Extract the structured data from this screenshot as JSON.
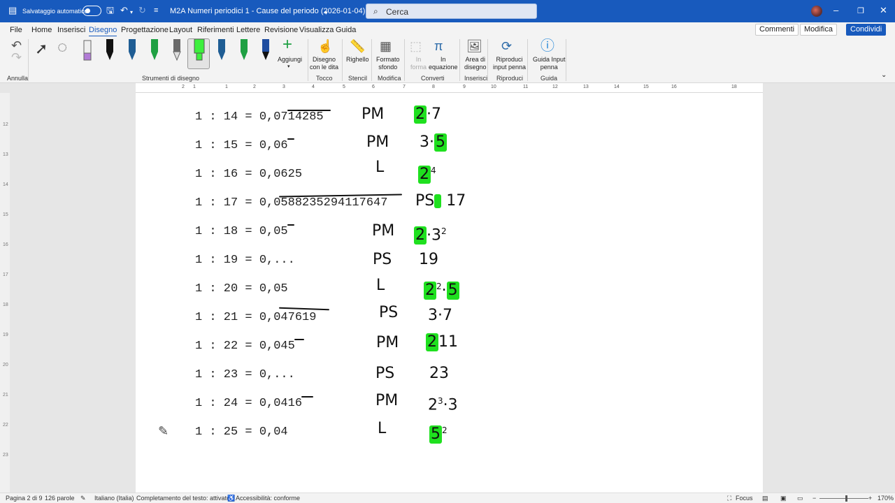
{
  "titlebar": {
    "autosave_label": "Salvataggio automatico",
    "doc_title": "M2A Numeri periodici 1 - Cause del periodo (2026-01-04).docx",
    "search_placeholder": "Cerca"
  },
  "tabs": [
    "File",
    "Home",
    "Inserisci",
    "Disegno",
    "Progettazione",
    "Layout",
    "Riferimenti",
    "Lettere",
    "Revisione",
    "Visualizza",
    "Guida"
  ],
  "active_tab": "Disegno",
  "top_buttons": {
    "comments": "Commenti",
    "edit": "Modifica",
    "share": "Condividi"
  },
  "ribbon": {
    "undo_group": "Annulla",
    "drawing_tools_group": "Strumenti di disegno",
    "add_pen": "Aggiungi",
    "finger_draw": "Disegno\ncon le dita",
    "touch_group": "Tocco",
    "ruler": "Righello",
    "stencils_group": "Stencil",
    "background_format": "Formato\nsfondo",
    "modify_group": "Modifica",
    "to_shape": "In\nforma",
    "to_math": "In\nequazione",
    "convert_group": "Converti",
    "drawing_canvas": "Area di\ndisegno",
    "insert_group": "Inserisci",
    "ink_replay": "Riproduci\ninput penna",
    "replay_group": "Riproduci",
    "ink_guide": "Guida Input\npenna",
    "guide_group": "Guida",
    "pen_colors": [
      "#111111",
      "#1f5d94",
      "#1fa043",
      "#6a6a6a",
      "#3df03d",
      "#1f5d94",
      "#1fa043",
      "#1f4da0"
    ]
  },
  "ruler_numbers": [
    "2",
    "1",
    "1",
    "2",
    "3",
    "4",
    "5",
    "6",
    "7",
    "8",
    "9",
    "10",
    "11",
    "12",
    "13",
    "14",
    "15",
    "16",
    "18"
  ],
  "vruler_numbers": [
    "12",
    "13",
    "14",
    "15",
    "16",
    "17",
    "18",
    "19",
    "20",
    "21",
    "22",
    "23"
  ],
  "rows": [
    {
      "expr": "1 : 14 = 0,0714285",
      "type": "PM",
      "fact": "2·7"
    },
    {
      "expr": "1 : 15 = 0,06",
      "type": "PM",
      "fact": "3·5"
    },
    {
      "expr": "1 : 16 = 0,0625",
      "type": "L",
      "fact": "2⁴"
    },
    {
      "expr": "1 : 17 = 0,0588235294117647",
      "type": "PS",
      "fact": "17"
    },
    {
      "expr": "1 : 18 = 0,05",
      "type": "PM",
      "fact": "2·3²"
    },
    {
      "expr": "1 : 19 = 0,...",
      "type": "PS",
      "fact": "19"
    },
    {
      "expr": "1 : 20 = 0,05",
      "type": "L",
      "fact": "2²·5"
    },
    {
      "expr": "1 : 21 = 0,047619",
      "type": "PS",
      "fact": "3·7"
    },
    {
      "expr": "1 : 22 = 0,045",
      "type": "PM",
      "fact": "2·11"
    },
    {
      "expr": "1 : 23 = 0,...",
      "type": "PS",
      "fact": "23"
    },
    {
      "expr": "1 : 24 = 0,0416",
      "type": "PM",
      "fact": "2³·3"
    },
    {
      "expr": "1 : 25 = 0,04",
      "type": "L",
      "fact": "5²"
    }
  ],
  "hw_parts": {
    "r1": [
      "2",
      "·7"
    ],
    "r2": [
      "3·",
      "5"
    ],
    "r3": [
      "2",
      "4"
    ],
    "r4": [
      "PS",
      "17"
    ],
    "r5": [
      "2",
      "·3",
      "2"
    ],
    "r7": [
      "2",
      "2",
      "·",
      "5"
    ],
    "r9": [
      "2",
      "11"
    ],
    "r11": [
      "2",
      "3",
      "·3"
    ],
    "r12": [
      "5",
      "2"
    ]
  },
  "statusbar": {
    "page": "Pagina 2 di 9",
    "words": "126 parole",
    "language": "Italiano (Italia)",
    "autocomplete": "Completamento del testo: attivato",
    "accessibility": "Accessibilità: conforme",
    "focus": "Focus",
    "zoom": "170%"
  }
}
